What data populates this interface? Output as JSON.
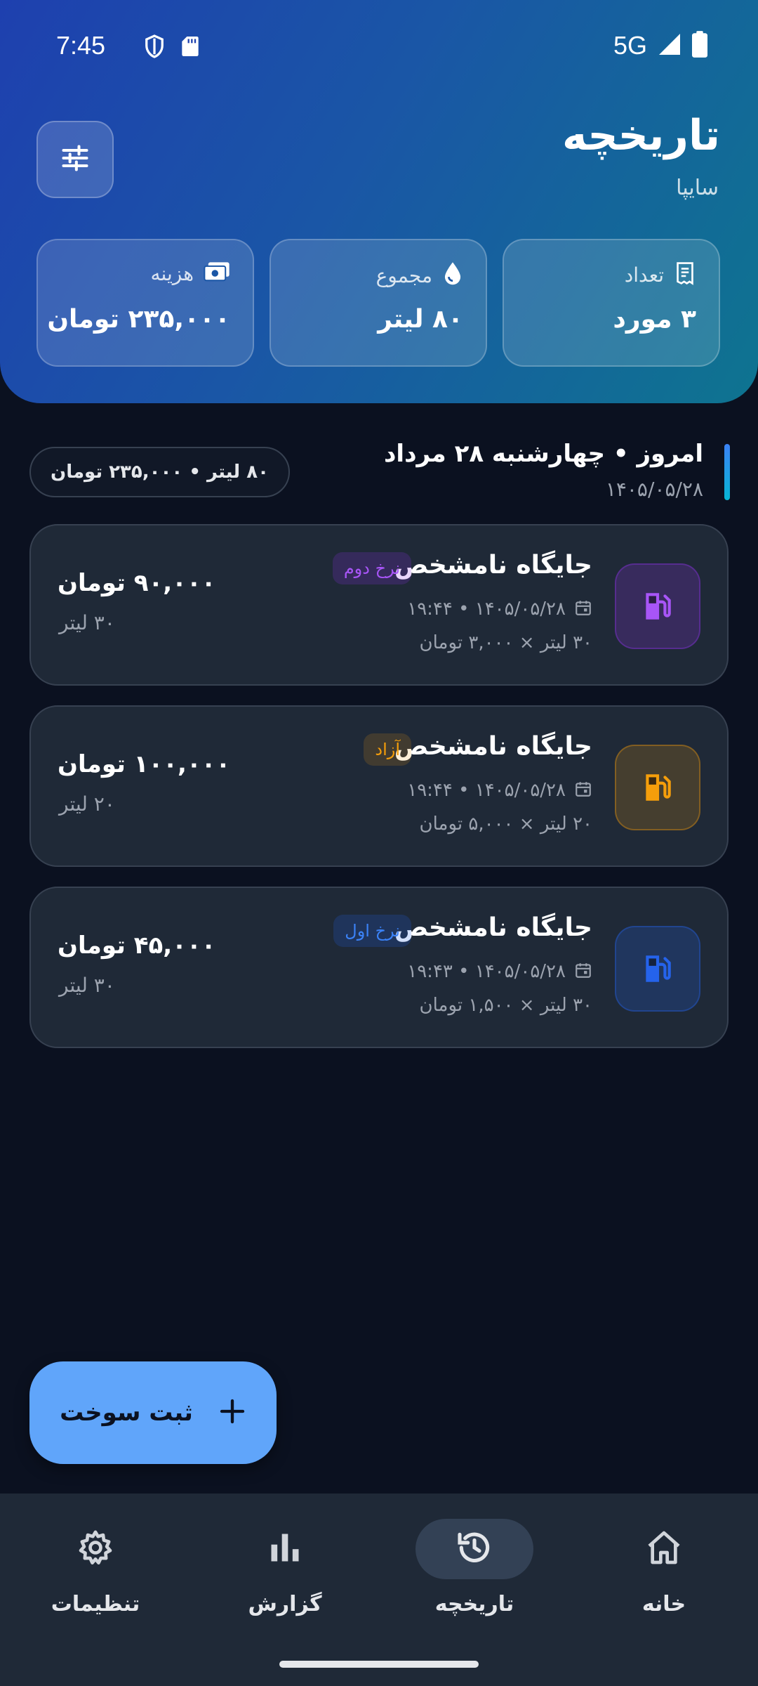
{
  "status_bar": {
    "time": "7:45",
    "network": "5G"
  },
  "header": {
    "title": "تاریخچه",
    "subtitle": "سایپا"
  },
  "stats": [
    {
      "label": "تعداد",
      "value": "۳ مورد",
      "icon": "receipt-icon"
    },
    {
      "label": "مجموع",
      "value": "۸۰ لیتر",
      "icon": "drop-icon"
    },
    {
      "label": "هزینه",
      "value": "۲۳۵,۰۰۰ تومان",
      "icon": "cash-icon"
    }
  ],
  "section": {
    "title": "امروز • چهارشنبه ۲۸ مرداد",
    "date": "۱۴۰۵/۰۵/۲۸",
    "summary": "۸۰ لیتر • ۲۳۵,۰۰۰ تومان"
  },
  "transactions": [
    {
      "title": "جایگاه نامشخص",
      "badge": "نرخ دوم",
      "badge_color": "#a855f7",
      "icon_color": "#9333ea",
      "datetime": "۱۴۰۵/۰۵/۲۸ • ۱۹:۴۴",
      "calc": "۳۰ لیتر × ۳,۰۰۰ تومان",
      "amount": "۹۰,۰۰۰ تومان",
      "liters": "۳۰ لیتر"
    },
    {
      "title": "جایگاه نامشخص",
      "badge": "آزاد",
      "badge_color": "#f59e0b",
      "icon_color": "#f59e0b",
      "datetime": "۱۴۰۵/۰۵/۲۸ • ۱۹:۴۴",
      "calc": "۲۰ لیتر × ۵,۰۰۰ تومان",
      "amount": "۱۰۰,۰۰۰ تومان",
      "liters": "۲۰ لیتر"
    },
    {
      "title": "جایگاه نامشخص",
      "badge": "نرخ اول",
      "badge_color": "#3b82f6",
      "icon_color": "#2563eb",
      "datetime": "۱۴۰۵/۰۵/۲۸ • ۱۹:۴۳",
      "calc": "۳۰ لیتر × ۱,۵۰۰ تومان",
      "amount": "۴۵,۰۰۰ تومان",
      "liters": "۳۰ لیتر"
    }
  ],
  "fab": {
    "label": "ثبت سوخت"
  },
  "nav": [
    {
      "label": "خانه",
      "icon": "home-icon",
      "active": false
    },
    {
      "label": "تاریخچه",
      "icon": "history-icon",
      "active": true
    },
    {
      "label": "گزارش",
      "icon": "bar-chart-icon",
      "active": false
    },
    {
      "label": "تنظیمات",
      "icon": "gear-icon",
      "active": false
    }
  ]
}
